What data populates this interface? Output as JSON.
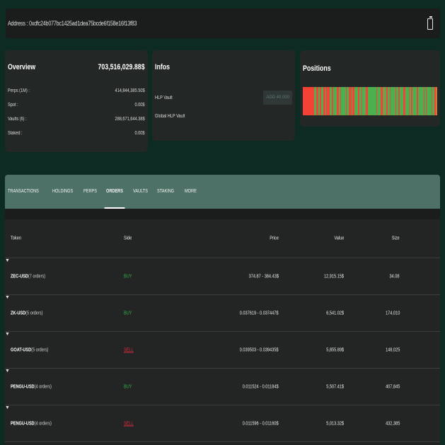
{
  "address": {
    "label": "Address : 0xdfc24b077bc1425ad1dea75bcde6f158e16f13f83"
  },
  "overview": {
    "title": "Overview",
    "total": "703,516,029.88$",
    "rows": [
      {
        "label": "Perps (1M) :",
        "value": "414,844,385.50$"
      },
      {
        "label": "Spot :",
        "value": "0.00$"
      },
      {
        "label": "Vaults (6) :",
        "value": "288,671,644.38$"
      },
      {
        "label": "Staked :",
        "value": "0.00$"
      }
    ]
  },
  "infos": {
    "title": "Infos",
    "hlp_label": "HLP Vault",
    "add_button": "ADD 40,000",
    "global_label": "Global HLP Vault"
  },
  "positions": {
    "title": "Positions",
    "colors": {
      "long": "#4caf50",
      "short": "#f44336",
      "mixed": "#c97a3a"
    }
  },
  "tabs": [
    {
      "label": "TRANSACTIONS",
      "active": false
    },
    {
      "label": "HOLDINGS",
      "active": false
    },
    {
      "label": "PERPS",
      "active": false
    },
    {
      "label": "ORDERS",
      "active": true
    },
    {
      "label": "VAULTS",
      "active": false
    },
    {
      "label": "STAKING",
      "active": false
    },
    {
      "label": "MORE",
      "active": false
    }
  ],
  "table": {
    "headers": {
      "token": "Token",
      "side": "Side",
      "price": "Price",
      "value": "Value",
      "size": "Size"
    },
    "rows": [
      {
        "token": "ZEC-USD",
        "orders": "(7 orders)",
        "side": "BUY",
        "price": "374.87 - 384.43$",
        "value": "12,915.15$",
        "size": "34.08"
      },
      {
        "token": "ZK-USD",
        "orders": "(5 orders)",
        "side": "BUY",
        "price": "0.037619 - 0.037447$",
        "value": "6,541.02$",
        "size": "174,010"
      },
      {
        "token": "GOAT-USD",
        "orders": "(5 orders)",
        "side": "SELL",
        "price": "0.039503 - 0.039435$",
        "value": "5,855.89$",
        "size": "148,025"
      },
      {
        "token": "PENGU-USD",
        "orders": "(4 orders)",
        "side": "BUY",
        "price": "0.011524 - 0.01184$",
        "value": "5,507.41$",
        "size": "407,845"
      },
      {
        "token": "PENGU-USD",
        "orders": "(4 orders)",
        "side": "SELL",
        "price": "0.011596 - 0.01160$",
        "value": "5,013.32$",
        "size": "432,385"
      }
    ],
    "expand_icon": "chevron-down-icon"
  }
}
